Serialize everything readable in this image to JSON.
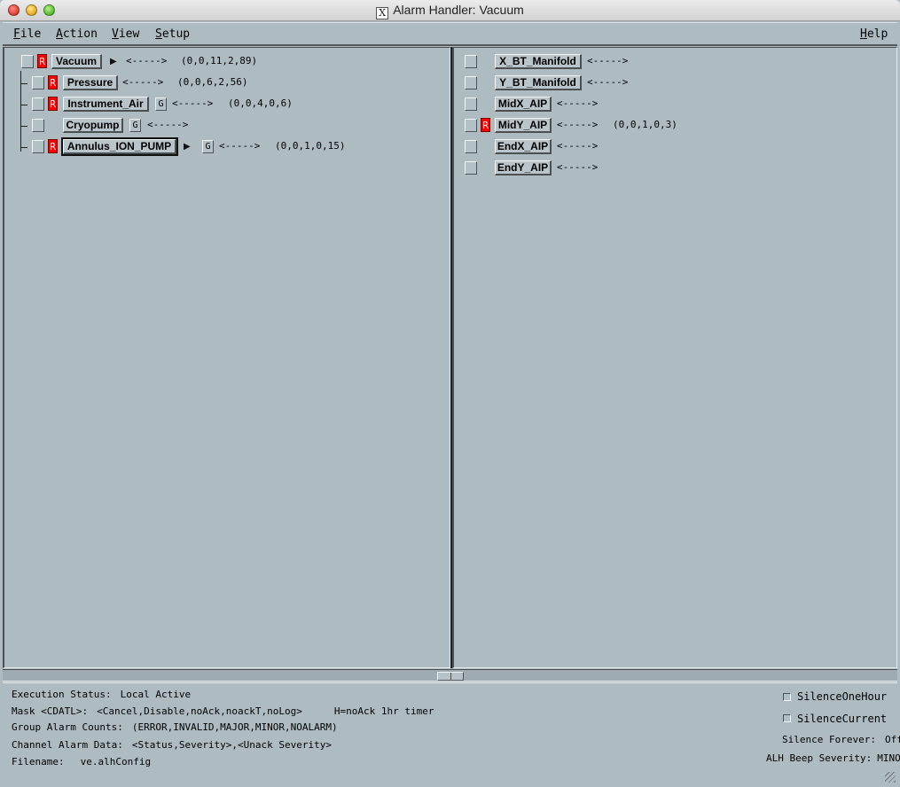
{
  "window": {
    "title": "Alarm Handler: Vacuum",
    "logo": "X"
  },
  "menu": {
    "file": "File",
    "action": "Action",
    "view": "View",
    "setup": "Setup",
    "help": "Help"
  },
  "left_tree": {
    "vacuum": {
      "flag": "R",
      "label": "Vacuum",
      "link": "<----->",
      "counts": "(0,0,11,2,89)"
    },
    "pressure": {
      "flag": "R",
      "label": "Pressure",
      "link": "<----->",
      "counts": "(0,0,6,2,56)"
    },
    "instrument_air": {
      "flag": "R",
      "label": "Instrument_Air",
      "guidance": "G",
      "link": "<----->",
      "counts": "(0,0,4,0,6)"
    },
    "cryopump": {
      "label": "Cryopump",
      "guidance": "G",
      "link": "<----->"
    },
    "annulus_ion_pump": {
      "flag": "R",
      "label": "Annulus_ION_PUMP",
      "guidance": "G",
      "link": "<----->",
      "counts": "(0,0,1,0,15)"
    }
  },
  "right_list": {
    "x_bt_manifold": {
      "label": "X_BT_Manifold",
      "link": "<----->"
    },
    "y_bt_manifold": {
      "label": "Y_BT_Manifold",
      "link": "<----->"
    },
    "midx_aip": {
      "label": "MidX_AIP",
      "link": "<----->"
    },
    "midy_aip": {
      "flag": "R",
      "label": "MidY_AIP",
      "link": "<----->",
      "counts": "(0,0,1,0,3)"
    },
    "endx_aip": {
      "label": "EndX_AIP",
      "link": "<----->"
    },
    "endy_aip": {
      "label": "EndY_AIP",
      "link": "<----->"
    }
  },
  "status": {
    "execution_label": "Execution Status:",
    "execution_value": "Local Active",
    "mask_label": "Mask <CDATL>:",
    "mask_value": "<Cancel,Disable,noAck,noackT,noLog>",
    "mask_note": "H=noAck 1hr timer",
    "group_label": "Group Alarm Counts:",
    "group_value": "(ERROR,INVALID,MAJOR,MINOR,NOALARM)",
    "channel_label": "Channel Alarm Data:",
    "channel_value": "<Status,Severity>,<Unack Severity>",
    "filename_label": "Filename:",
    "filename_value": "ve.alhConfig",
    "silence_one_hour": "SilenceOneHour",
    "silence_current": "SilenceCurrent",
    "silence_forever_label": "Silence Forever:",
    "silence_forever_value": "Off",
    "beep_label": "ALH Beep Severity:",
    "beep_value": "MINOR"
  },
  "colors": {
    "background": "#aebcc2",
    "alarm_red": "#ff0000"
  }
}
